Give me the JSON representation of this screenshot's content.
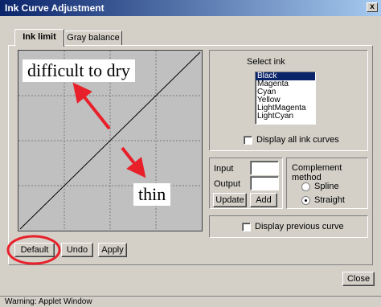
{
  "window": {
    "title": "Ink Curve Adjustment",
    "close_glyph": "x"
  },
  "tabs": [
    {
      "label": "Ink limit",
      "active": true
    },
    {
      "label": "Gray balance",
      "active": false
    }
  ],
  "annotations": {
    "top": "difficult to dry",
    "bottom": "thin"
  },
  "select_ink": {
    "label": "Select ink",
    "items": [
      "Black",
      "Magenta",
      "Cyan",
      "Yellow",
      "LightMagenta",
      "LightCyan"
    ],
    "selected": "Black",
    "display_all_label": "Display all ink curves"
  },
  "io": {
    "input_label": "Input",
    "input_value": "",
    "output_label": "Output",
    "output_value": "",
    "update_label": "Update",
    "add_label": "Add"
  },
  "complement": {
    "label": "Complement method",
    "options": [
      "Spline",
      "Straight"
    ],
    "selected": "Straight"
  },
  "display_previous_label": "Display previous curve",
  "buttons": {
    "default": "Default",
    "undo": "Undo",
    "apply": "Apply",
    "close": "Close"
  },
  "status": "Warning: Applet Window",
  "colors": {
    "highlight_red": "#e8202a",
    "titlebar": "#0a246a"
  }
}
